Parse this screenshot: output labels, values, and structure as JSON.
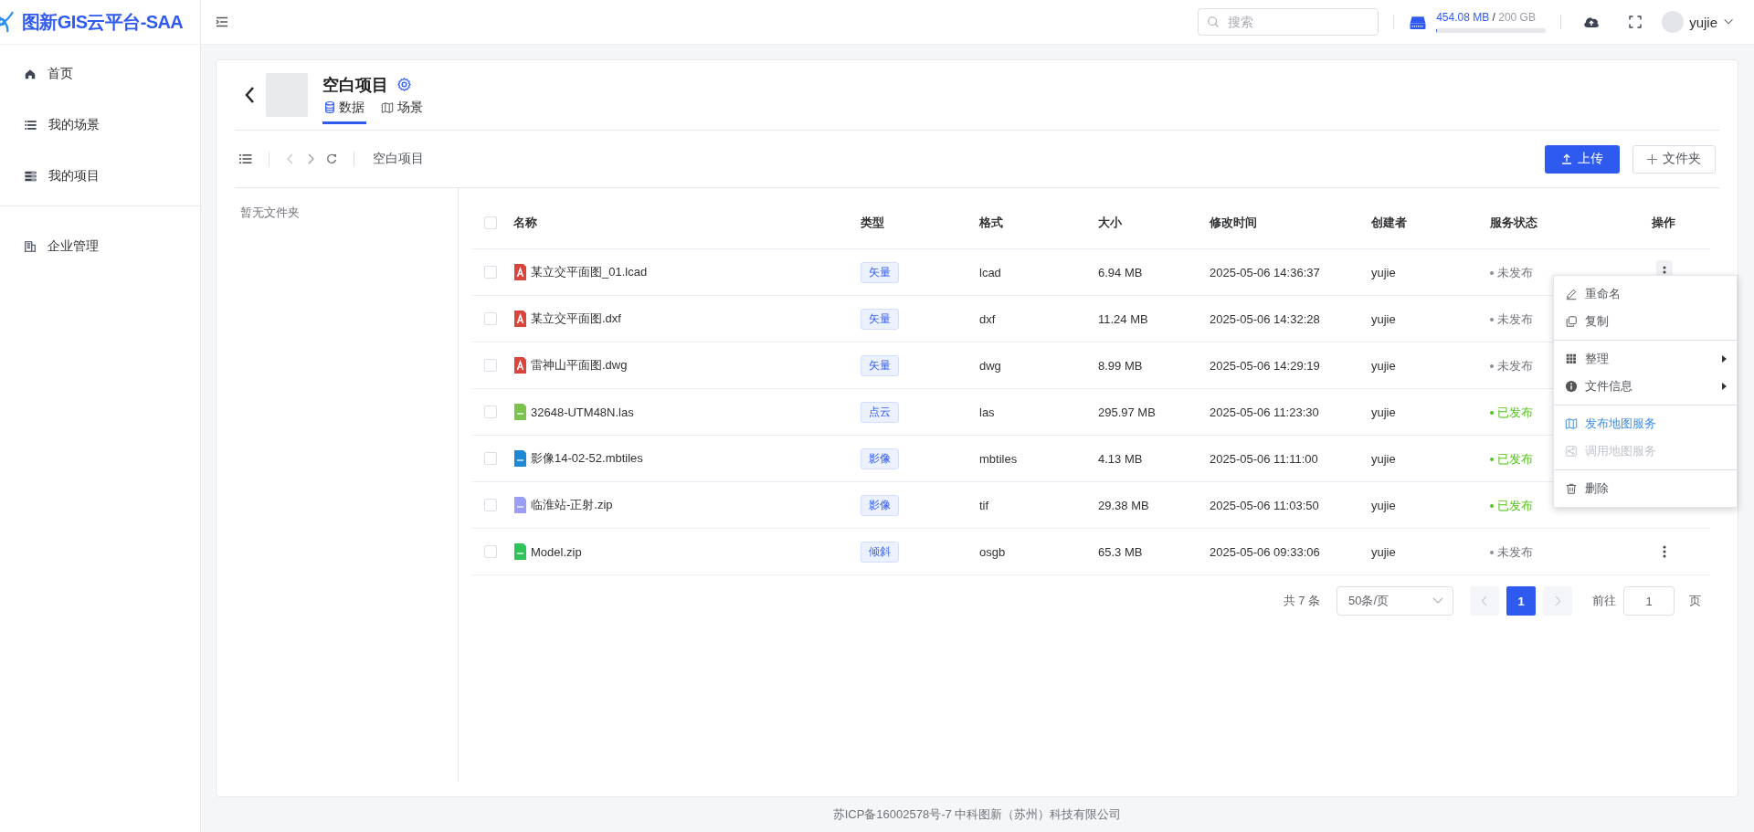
{
  "brand": {
    "title": "图新GIS云平台-SAA"
  },
  "header": {
    "search": {
      "placeholder": "搜索"
    },
    "storage": {
      "used": "454.08 MB",
      "separator": "/",
      "total": "200 GB",
      "level": 0.002
    },
    "user": {
      "name": "yujie"
    }
  },
  "sidebar": {
    "items": [
      {
        "label": "首页",
        "selected": false,
        "divider_before": false
      },
      {
        "label": "我的场景",
        "selected": false,
        "divider_before": false
      },
      {
        "label": "我的项目",
        "selected": false,
        "divider_before": false
      },
      {
        "label": "企业管理",
        "selected": false,
        "divider_before": true
      }
    ]
  },
  "project": {
    "title": "空白项目",
    "tabs": [
      {
        "label": "数据",
        "selected": true
      },
      {
        "label": "场景",
        "selected": false
      }
    ]
  },
  "toolbar": {
    "breadcrumb": "空白项目",
    "upload_button": "上传",
    "folder_button": "文件夹"
  },
  "folders": {
    "empty_text": "暂无文件夹"
  },
  "table": {
    "all_checked": false,
    "columns": [
      "名称",
      "类型",
      "格式",
      "大小",
      "修改时间",
      "创建者",
      "服务状态",
      "操作"
    ],
    "rows": [
      {
        "checked": false,
        "kind": "cad",
        "color": "#d9453d",
        "name": "某立交平面图_01.lcad",
        "type": "矢量",
        "format": "lcad",
        "size": "6.94 MB",
        "modified": "2025-05-06 14:36:37",
        "creator": "yujie",
        "status": "未发布",
        "published": false,
        "menu_button_visible": true,
        "menu_open": true
      },
      {
        "checked": false,
        "kind": "cad",
        "color": "#d9453d",
        "name": "某立交平面图.dxf",
        "type": "矢量",
        "format": "dxf",
        "size": "11.24 MB",
        "modified": "2025-05-06 14:32:28",
        "creator": "yujie",
        "status": "未发布",
        "published": false,
        "menu_button_visible": false
      },
      {
        "checked": false,
        "kind": "cad",
        "color": "#d9453d",
        "name": "雷神山平面图.dwg",
        "type": "矢量",
        "format": "dwg",
        "size": "8.99 MB",
        "modified": "2025-05-06 14:29:19",
        "creator": "yujie",
        "status": "未发布",
        "published": false,
        "menu_button_visible": false
      },
      {
        "checked": false,
        "kind": "labeled",
        "color": "#7cc24c",
        "name": "32648-UTM48N.las",
        "type": "点云",
        "format": "las",
        "size": "295.97 MB",
        "modified": "2025-05-06 11:23:30",
        "creator": "yujie",
        "status": "已发布",
        "published": true,
        "menu_button_visible": false
      },
      {
        "checked": false,
        "kind": "labeled",
        "color": "#1d88d6",
        "name": "影像14-02-52.mbtiles",
        "type": "影像",
        "format": "mbtiles",
        "size": "4.13 MB",
        "modified": "2025-05-06 11:11:00",
        "creator": "yujie",
        "status": "已发布",
        "published": true,
        "menu_button_visible": false
      },
      {
        "checked": false,
        "kind": "labeled",
        "color": "#9c9ef6",
        "name": "临淮站-正射.zip",
        "type": "影像",
        "format": "tif",
        "size": "29.38 MB",
        "modified": "2025-05-06 11:03:50",
        "creator": "yujie",
        "status": "已发布",
        "published": true,
        "menu_button_visible": false
      },
      {
        "checked": false,
        "kind": "labeled",
        "color": "#2ec45a",
        "name": "Model.zip",
        "type": "倾斜",
        "format": "osgb",
        "size": "65.3 MB",
        "modified": "2025-05-06 09:33:06",
        "creator": "yujie",
        "status": "未发布",
        "published": false,
        "menu_button_visible": true,
        "menu_open": false
      }
    ]
  },
  "context_menu": {
    "groups": [
      [
        {
          "label": "重命名",
          "highlighted": false,
          "disabled": false,
          "submenu": false
        },
        {
          "label": "复制",
          "highlighted": false,
          "disabled": false,
          "submenu": false
        }
      ],
      [
        {
          "label": "整理",
          "highlighted": false,
          "disabled": false,
          "submenu": true
        },
        {
          "label": "文件信息",
          "highlighted": false,
          "disabled": false,
          "submenu": true
        }
      ],
      [
        {
          "label": "发布地图服务",
          "highlighted": true,
          "disabled": false,
          "submenu": false
        },
        {
          "label": "调用地图服务",
          "highlighted": false,
          "disabled": true,
          "submenu": false
        }
      ],
      [
        {
          "label": "删除",
          "highlighted": false,
          "disabled": false,
          "submenu": false
        }
      ]
    ]
  },
  "pagination": {
    "total": "共 7 条",
    "page_size": "50条/页",
    "pages": [
      {
        "label": "1",
        "selected": true
      }
    ],
    "goto_label": "前往",
    "goto_value": "1",
    "goto_suffix": "页"
  },
  "footer": {
    "text": "苏ICP备16002578号-7 中科图新（苏州）科技有限公司"
  }
}
